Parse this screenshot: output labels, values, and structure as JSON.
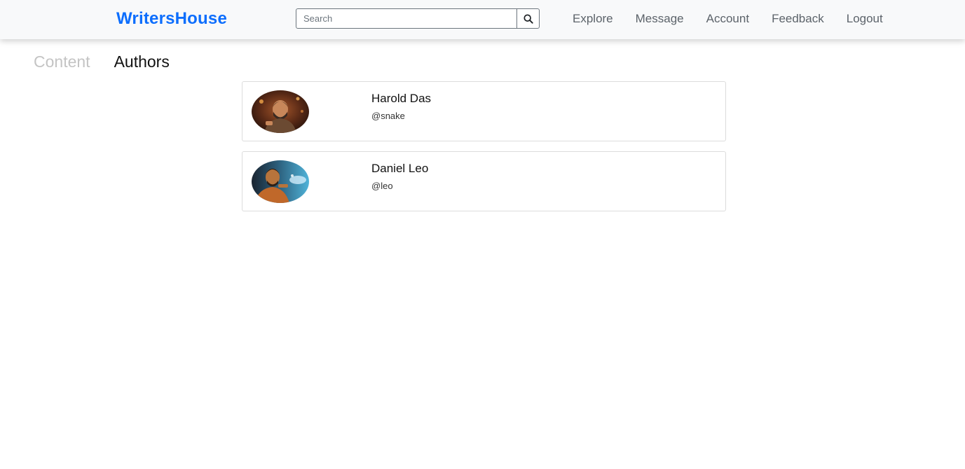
{
  "navbar": {
    "brand": "WritersHouse",
    "search_placeholder": "Search",
    "search_icon": "search-icon",
    "links": [
      "Explore",
      "Message",
      "Account",
      "Feedback",
      "Logout"
    ]
  },
  "tabs": [
    {
      "label": "Content",
      "active": false
    },
    {
      "label": "Authors",
      "active": true
    }
  ],
  "authors": [
    {
      "name": "Harold Das",
      "handle": "@snake",
      "avatar": "avatar-photo"
    },
    {
      "name": "Daniel Leo",
      "handle": "@leo",
      "avatar": "avatar-photo"
    }
  ],
  "colors": {
    "brand": "#0d6efd",
    "nav_bg": "#f8f9fa",
    "nav_link": "#5c636a",
    "tab_inactive": "#c4c4c4",
    "tab_active": "#111111"
  }
}
